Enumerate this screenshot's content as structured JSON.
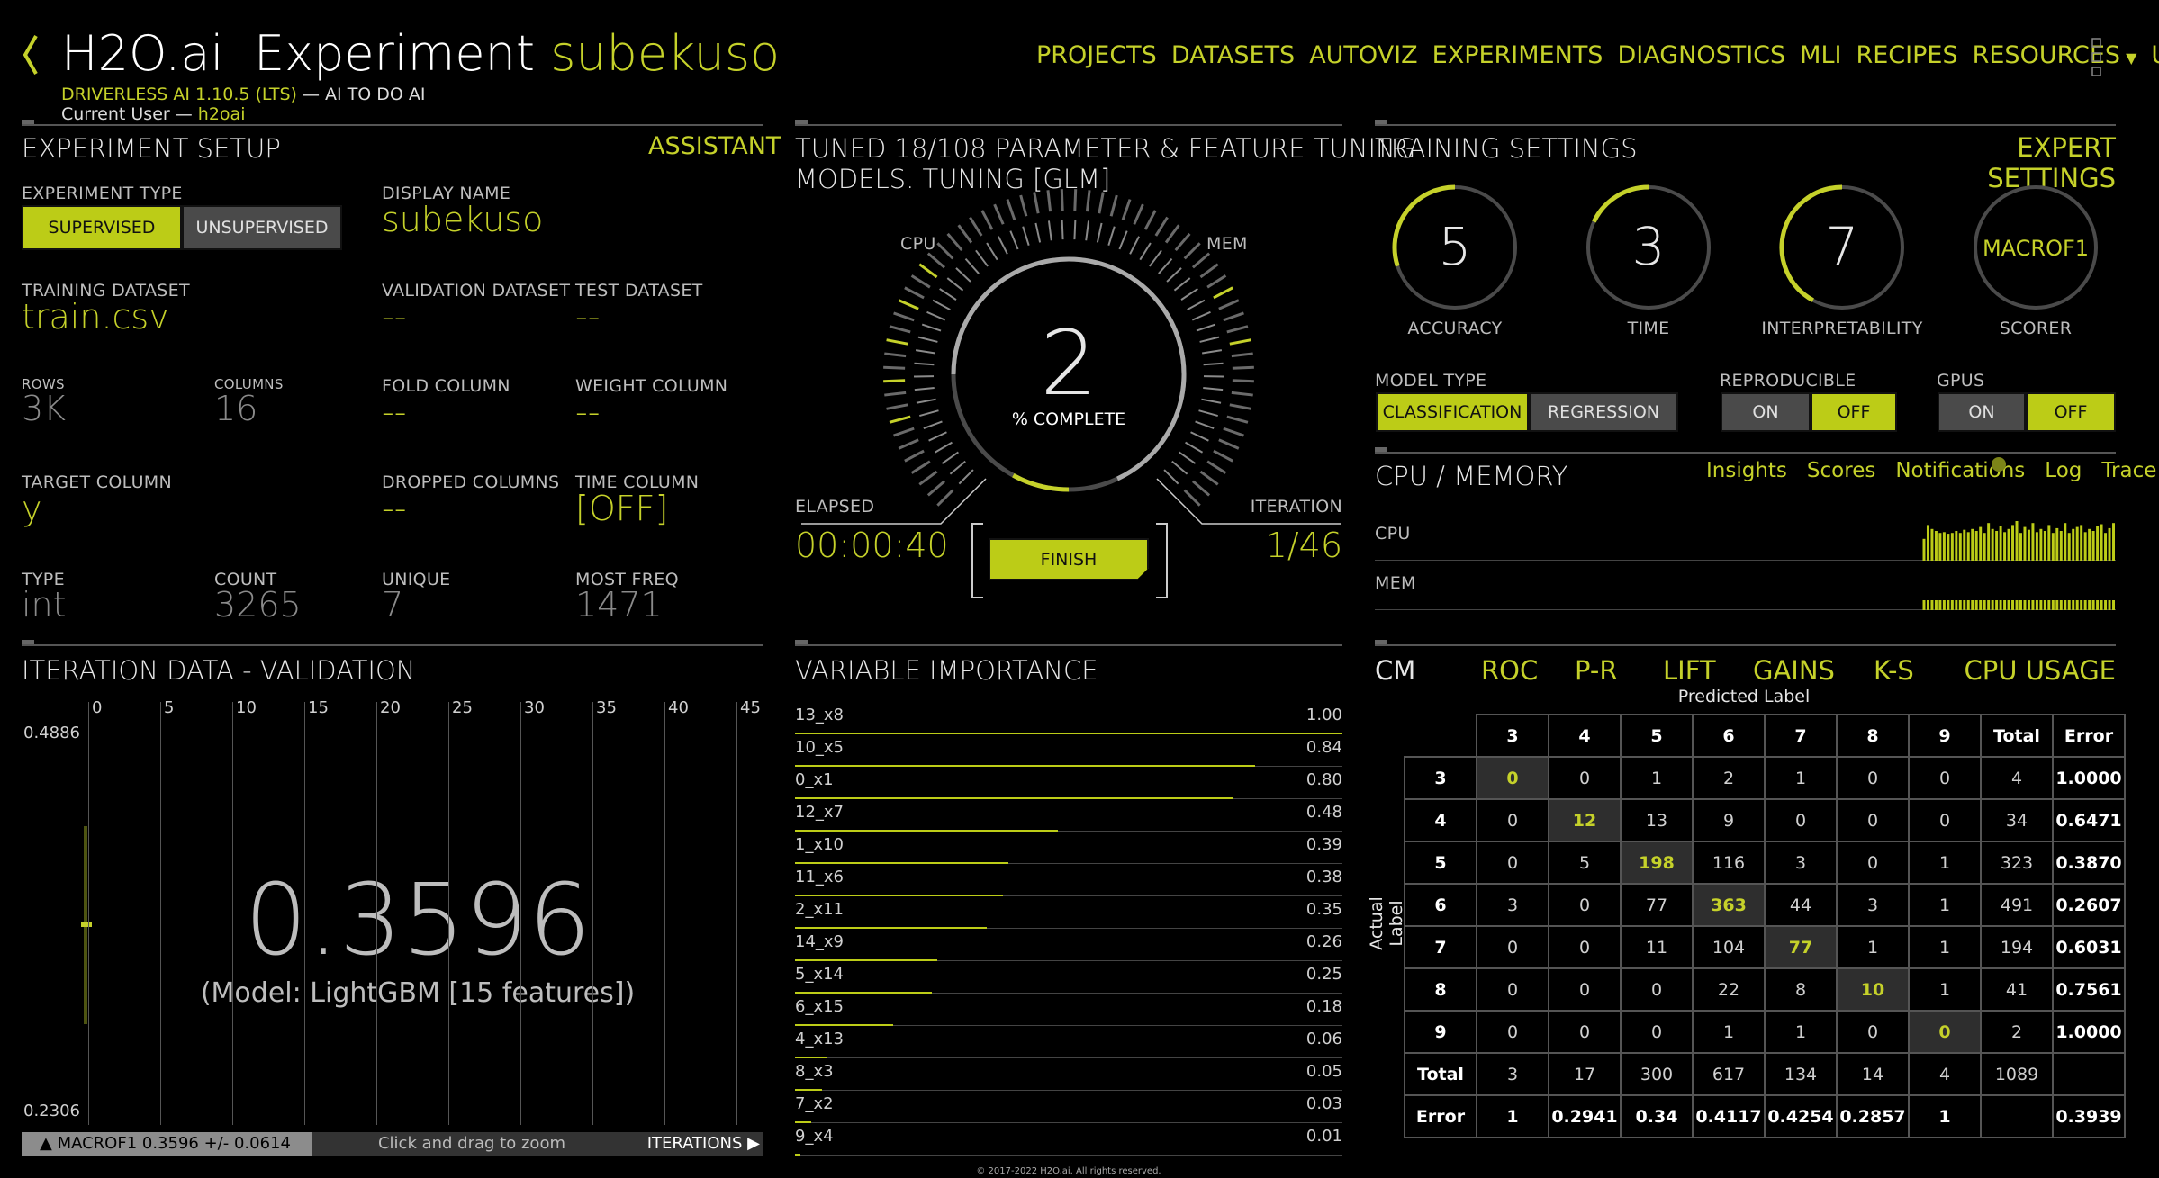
{
  "header": {
    "back_icon": "chevron-left-icon",
    "logo": "H2O.ai",
    "title_prefix": "Experiment",
    "title_name": "subekuso",
    "product_line": "DRIVERLESS AI 1.10.5 (LTS)",
    "product_tagline": " — AI TO DO AI",
    "user_prefix": "Current User — ",
    "user_name": "h2oai"
  },
  "nav": {
    "items": [
      "PROJECTS",
      "DATASETS",
      "AUTOVIZ",
      "EXPERIMENTS",
      "DIAGNOSTICS",
      "MLI",
      "RECIPES",
      "RESOURCES",
      "USER"
    ],
    "resources_icon": "caret-down-icon",
    "user_icon": "caret-down-icon",
    "menu_icon": "grid-menu-icon"
  },
  "setup": {
    "title": "EXPERIMENT SETUP",
    "assistant": "ASSISTANT",
    "experiment_type_label": "EXPERIMENT TYPE",
    "supervised": "SUPERVISED",
    "unsupervised": "UNSUPERVISED",
    "display_name_label": "DISPLAY NAME",
    "display_name": "subekuso",
    "training_dataset_label": "TRAINING DATASET",
    "training_dataset": "train.csv",
    "validation_dataset_label": "VALIDATION DATASET",
    "validation_dataset": "--",
    "test_dataset_label": "TEST DATASET",
    "test_dataset": "--",
    "rows_label": "ROWS",
    "rows": "3K",
    "columns_label": "COLUMNS",
    "columns": "16",
    "fold_column_label": "FOLD COLUMN",
    "fold_column": "--",
    "weight_column_label": "WEIGHT COLUMN",
    "weight_column": "--",
    "target_column_label": "TARGET COLUMN",
    "target_column": "y",
    "dropped_columns_label": "DROPPED COLUMNS",
    "dropped_columns": "--",
    "time_column_label": "TIME COLUMN",
    "time_column": "[OFF]",
    "type_label": "TYPE",
    "type": "int",
    "count_label": "COUNT",
    "count": "3265",
    "unique_label": "UNIQUE",
    "unique": "7",
    "most_freq_label": "MOST FREQ",
    "most_freq": "1471"
  },
  "status": {
    "title_line1": "TUNED 18/108 PARAMETER & FEATURE TUNING",
    "title_line2": "MODELS. TUNING [GLM]",
    "cpu_label": "CPU",
    "mem_label": "MEM",
    "percent": "2",
    "percent_label": "% COMPLETE",
    "progress_fraction": 0.02,
    "elapsed_label": "ELAPSED",
    "elapsed": "00:00:40",
    "iteration_label": "ITERATION",
    "iteration": "1/46",
    "finish": "FINISH"
  },
  "training": {
    "title": "TRAINING SETTINGS",
    "expert": "EXPERT SETTINGS",
    "dials": [
      {
        "value": "5",
        "label": "ACCURACY",
        "fraction": 0.5
      },
      {
        "value": "3",
        "label": "TIME",
        "fraction": 0.3
      },
      {
        "value": "7",
        "label": "INTERPRETABILITY",
        "fraction": 0.7
      },
      {
        "value": "MACROF1",
        "label": "SCORER",
        "fraction": 0
      }
    ],
    "model_type_label": "MODEL TYPE",
    "classification": "CLASSIFICATION",
    "regression": "REGRESSION",
    "reproducible_label": "REPRODUCIBLE",
    "repro_on": "ON",
    "repro_off": "OFF",
    "gpus_label": "GPUS",
    "gpus_on": "ON",
    "gpus_off": "OFF"
  },
  "cpu_memory": {
    "title": "CPU / MEMORY",
    "tabs": [
      "Insights",
      "Scores",
      "Notifications",
      "Log",
      "Trace"
    ],
    "cpu_label": "CPU",
    "mem_label": "MEM",
    "cpu_bars": [
      0.55,
      0.9,
      0.8,
      0.75,
      0.7,
      0.72,
      0.68,
      0.7,
      0.75,
      0.7,
      0.78,
      0.72,
      0.8,
      0.75,
      0.85,
      0.7,
      0.95,
      0.8,
      0.75,
      0.88,
      0.72,
      0.8,
      0.9,
      1.0,
      0.7,
      0.85,
      0.78,
      0.95,
      0.72,
      0.8,
      0.75,
      0.9,
      0.7,
      0.82,
      0.75,
      0.95,
      0.7,
      0.8,
      0.85,
      0.9,
      0.72,
      0.8,
      0.75,
      0.88,
      0.92,
      0.7,
      0.82,
      0.95
    ],
    "mem_bars_count": 48
  },
  "iteration": {
    "title": "ITERATION DATA - VALIDATION",
    "x_ticks": [
      "0",
      "5",
      "10",
      "15",
      "20",
      "25",
      "30",
      "35",
      "40",
      "45"
    ],
    "y_max": "0.4886",
    "y_min": "0.2306",
    "score": "0.3596",
    "model": "(Model: LightGBM [15 features])",
    "footer_metric": "MACROF1 0.3596 +/- 0.0614",
    "footer_hint": "Click and drag to zoom",
    "footer_iterations": "ITERATIONS"
  },
  "varimp": {
    "title": "VARIABLE IMPORTANCE",
    "rows": [
      {
        "name": "13_x8",
        "value": "1.00",
        "v": 1.0
      },
      {
        "name": "10_x5",
        "value": "0.84",
        "v": 0.84
      },
      {
        "name": "0_x1",
        "value": "0.80",
        "v": 0.8
      },
      {
        "name": "12_x7",
        "value": "0.48",
        "v": 0.48
      },
      {
        "name": "1_x10",
        "value": "0.39",
        "v": 0.39
      },
      {
        "name": "11_x6",
        "value": "0.38",
        "v": 0.38
      },
      {
        "name": "2_x11",
        "value": "0.35",
        "v": 0.35
      },
      {
        "name": "14_x9",
        "value": "0.26",
        "v": 0.26
      },
      {
        "name": "5_x14",
        "value": "0.25",
        "v": 0.25
      },
      {
        "name": "6_x15",
        "value": "0.18",
        "v": 0.18
      },
      {
        "name": "4_x13",
        "value": "0.06",
        "v": 0.06
      },
      {
        "name": "8_x3",
        "value": "0.05",
        "v": 0.05
      },
      {
        "name": "7_x2",
        "value": "0.03",
        "v": 0.03
      },
      {
        "name": "9_x4",
        "value": "0.01",
        "v": 0.01
      }
    ]
  },
  "cm": {
    "tabs": [
      "CM",
      "ROC",
      "P-R",
      "LIFT",
      "GAINS",
      "K-S",
      "CPU USAGE"
    ],
    "predicted_label": "Predicted Label",
    "actual_label": "Actual Label",
    "header": [
      "",
      "3",
      "4",
      "5",
      "6",
      "7",
      "8",
      "9",
      "Total",
      "Error"
    ],
    "rows": [
      [
        "3",
        "0",
        "0",
        "1",
        "2",
        "1",
        "0",
        "0",
        "4",
        "1.0000"
      ],
      [
        "4",
        "0",
        "12",
        "13",
        "9",
        "0",
        "0",
        "0",
        "34",
        "0.6471"
      ],
      [
        "5",
        "0",
        "5",
        "198",
        "116",
        "3",
        "0",
        "1",
        "323",
        "0.3870"
      ],
      [
        "6",
        "3",
        "0",
        "77",
        "363",
        "44",
        "3",
        "1",
        "491",
        "0.2607"
      ],
      [
        "7",
        "0",
        "0",
        "11",
        "104",
        "77",
        "1",
        "1",
        "194",
        "0.6031"
      ],
      [
        "8",
        "0",
        "0",
        "0",
        "22",
        "8",
        "10",
        "1",
        "41",
        "0.7561"
      ],
      [
        "9",
        "0",
        "0",
        "0",
        "1",
        "1",
        "0",
        "0",
        "2",
        "1.0000"
      ],
      [
        "Total",
        "3",
        "17",
        "300",
        "617",
        "134",
        "14",
        "4",
        "1089",
        ""
      ],
      [
        "Error",
        "1",
        "0.2941",
        "0.34",
        "0.4117",
        "0.4254",
        "0.2857",
        "1",
        "",
        "0.3939"
      ]
    ]
  },
  "footer": {
    "copyright": "© 2017-2022 H2O.ai. All rights reserved."
  },
  "colors": {
    "accent": "#c5d12a",
    "background": "#000000",
    "button_off": "#4a4a4a"
  }
}
